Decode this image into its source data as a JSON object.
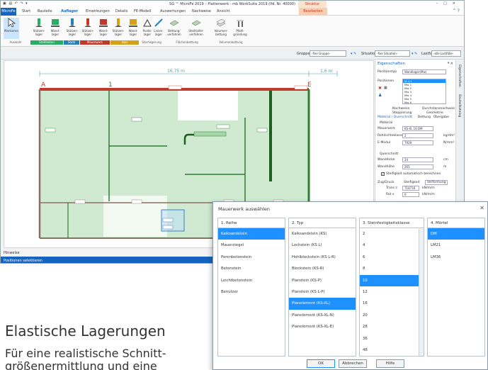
{
  "app": {
    "window_title": "SG ™ MicroFe 2019 – Plattenwerk - mb WorkSuite 2019 (lfd. Nr. 40000)",
    "context_title": "Struktur",
    "menu": [
      {
        "label": "MicroFe",
        "key": "file"
      },
      {
        "label": "Start",
        "key": "start"
      },
      {
        "label": "Bauteile",
        "key": "bauteile"
      },
      {
        "label": "Auflager",
        "key": "auflager"
      },
      {
        "label": "Einwirkungen",
        "key": "einwirkungen"
      },
      {
        "label": "Details",
        "key": "details"
      },
      {
        "label": "FE-Modell",
        "key": "fe-modell"
      },
      {
        "label": "Auswertungen",
        "key": "auswertungen"
      },
      {
        "label": "Nachweise",
        "key": "nachweise"
      },
      {
        "label": "Ansicht",
        "key": "ansicht"
      },
      {
        "label": "Bearbeiten",
        "key": "bearbeiten"
      }
    ],
    "ribbon_buttons": [
      {
        "label": "Markieren",
        "icon": "cursor-icon"
      },
      {
        "label": "Stützen-lager",
        "icon": "column-support-icon"
      },
      {
        "label": "Wand-lager",
        "icon": "wall-support-icon"
      },
      {
        "label": "Stützen-lager",
        "icon": "column-support-icon"
      },
      {
        "label": "Stützen-lager",
        "icon": "column-support-icon"
      },
      {
        "label": "Wand-lager",
        "icon": "wall-support-icon"
      },
      {
        "label": "Stützen-lager",
        "icon": "column-support-icon"
      },
      {
        "label": "Wand-lager",
        "icon": "wall-support-icon"
      },
      {
        "label": "Stützen-lager",
        "icon": "column-support-icon"
      },
      {
        "label": "Wand-lager",
        "icon": "wall-support-icon"
      },
      {
        "label": "Punkt-lager",
        "icon": "point-support-icon"
      },
      {
        "label": "Linien-lager",
        "icon": "line-support-icon"
      },
      {
        "label": "Bettung-verfahren",
        "icon": "bedding-icon"
      },
      {
        "label": "Steifezifer-verfahren",
        "icon": "bedding-icon"
      },
      {
        "label": "Volumen-bettung",
        "icon": "volume-bedding-icon"
      },
      {
        "label": "Pfahl-gründung",
        "icon": "pile-foundation-icon"
      }
    ],
    "ribbon_groups": [
      {
        "label": "Auswahl",
        "color": "#7f8c8d"
      },
      {
        "label": "Stahlbeton",
        "color": "#27ae60"
      },
      {
        "label": "Stahl",
        "color": "#2980b9"
      },
      {
        "label": "Mauerwerk",
        "color": "#c0392b"
      },
      {
        "label": "Holz",
        "color": "#d4a017"
      },
      {
        "label": "Starrlagerung",
        "color": "#7f8c8d"
      },
      {
        "label": "Flächenbettung",
        "color": "#7f8c8d"
      },
      {
        "label": "Volumenbettung",
        "color": "#7f8c8d"
      }
    ],
    "filter": {
      "gruppe_label": "Gruppe",
      "gruppe_value": "-fixe Gruppe-",
      "situation_label": "Situation",
      "situation_value": "-fixe Situation-",
      "lastfall_label": "Lastfall",
      "lastfall_value": "-alle Lastfälle-"
    },
    "canvas": {
      "dim_main": "16,75 m",
      "dim_right": "1,6 m",
      "axis_a": "A",
      "axis_1": "1",
      "axis_e": "E"
    },
    "hinweise": "Hinweise",
    "status": "Positionen selektieren",
    "properties": {
      "title": "Eigenschaften",
      "close": "ª ×",
      "positionstyp_label": "Positionstyp",
      "positionstyp_value": "Wandlager(Mw)",
      "positionen_label": "Positionen",
      "positionen": [
        "M-4.1",
        "Mw 1",
        "Mw 2",
        "Mw 3",
        "Mw 4",
        "Mw 5",
        "Mw 6"
      ],
      "tabs_row1": [
        "Nachweise",
        "Durchstanznachweis"
      ],
      "tabs_row2": [
        "Steppierung",
        "Geometrie"
      ],
      "tabs_row3": [
        "Material / Querschnitt",
        "Bettung",
        "Übergabe"
      ],
      "material_header": "Material",
      "mauerwerk_label": "Mauerwerk",
      "mauerwerk_value": "KS-XL 10 DM",
      "rohdichte_label": "Rohdichteklasse",
      "rohdichte_value": "2",
      "rohdichte_unit": "kg/dm³",
      "emodul_label": "E-Modul",
      "emodul_value": "7929",
      "emodul_unit": "N/mm²",
      "querschnitt_header": "Querschnitt",
      "wanddicke_label": "Wanddicke",
      "wanddicke_value": "24",
      "wanddicke_unit": "cm",
      "wandhoehe_label": "Wandhöhe",
      "wandhoehe_value": "265",
      "wandhoehe_unit": "m",
      "steifigkeit_label": "Steifigkeit automatisch berechnen",
      "zugdruck_label": "Zug/Druck",
      "steifigkeit_col": "Steifigkeit",
      "verformung_col": "Verformung",
      "row1_label": "Trans z",
      "row1_value": "718716",
      "row1_unit": "kN/m/m",
      "row2_label": "Rot x",
      "row2_value": "0",
      "row2_unit": "kN/m/m"
    },
    "side_tabs": [
      "Eigenschaften",
      "Bauteilkatalog"
    ]
  },
  "dialog": {
    "title": "Mauerwerk auswählen",
    "columns": [
      {
        "header": "1. Reihe",
        "selected": 0,
        "items": [
          "Kalksandstein",
          "Mauerziegel",
          "Porenbetonstein",
          "Betonstein",
          "Leichtbetonstein",
          "Benutzer"
        ]
      },
      {
        "header": "2. Typ",
        "selected": 6,
        "items": [
          "Kalksandstein (KS)",
          "Lochstein (KS L)",
          "Hohlblockstein (KS L-R)",
          "Blockstein (KS-R)",
          "Planstein (KS-P)",
          "Planstein (KS L-P)",
          "Planelement (KS-XL)",
          "Planelement (KS-XL-N)",
          "Planelement (KS-XL-E)"
        ]
      },
      {
        "header": "3. Steinfestigkeitsklasse",
        "selected": 4,
        "items": [
          "2",
          "4",
          "6",
          "8",
          "10",
          "12",
          "16",
          "20",
          "28",
          "36",
          "48",
          "60"
        ]
      },
      {
        "header": "4. Mörtel",
        "selected": 0,
        "items": [
          "DM",
          "LM21",
          "LM36"
        ]
      }
    ],
    "buttons": {
      "ok": "OK",
      "cancel": "Abbrechen",
      "help": "Hilfe"
    }
  },
  "page": {
    "heading": "Elastische Lagerungen",
    "line1": "Für eine realistische Schnitt-",
    "line2": "größenermittlung und eine"
  }
}
